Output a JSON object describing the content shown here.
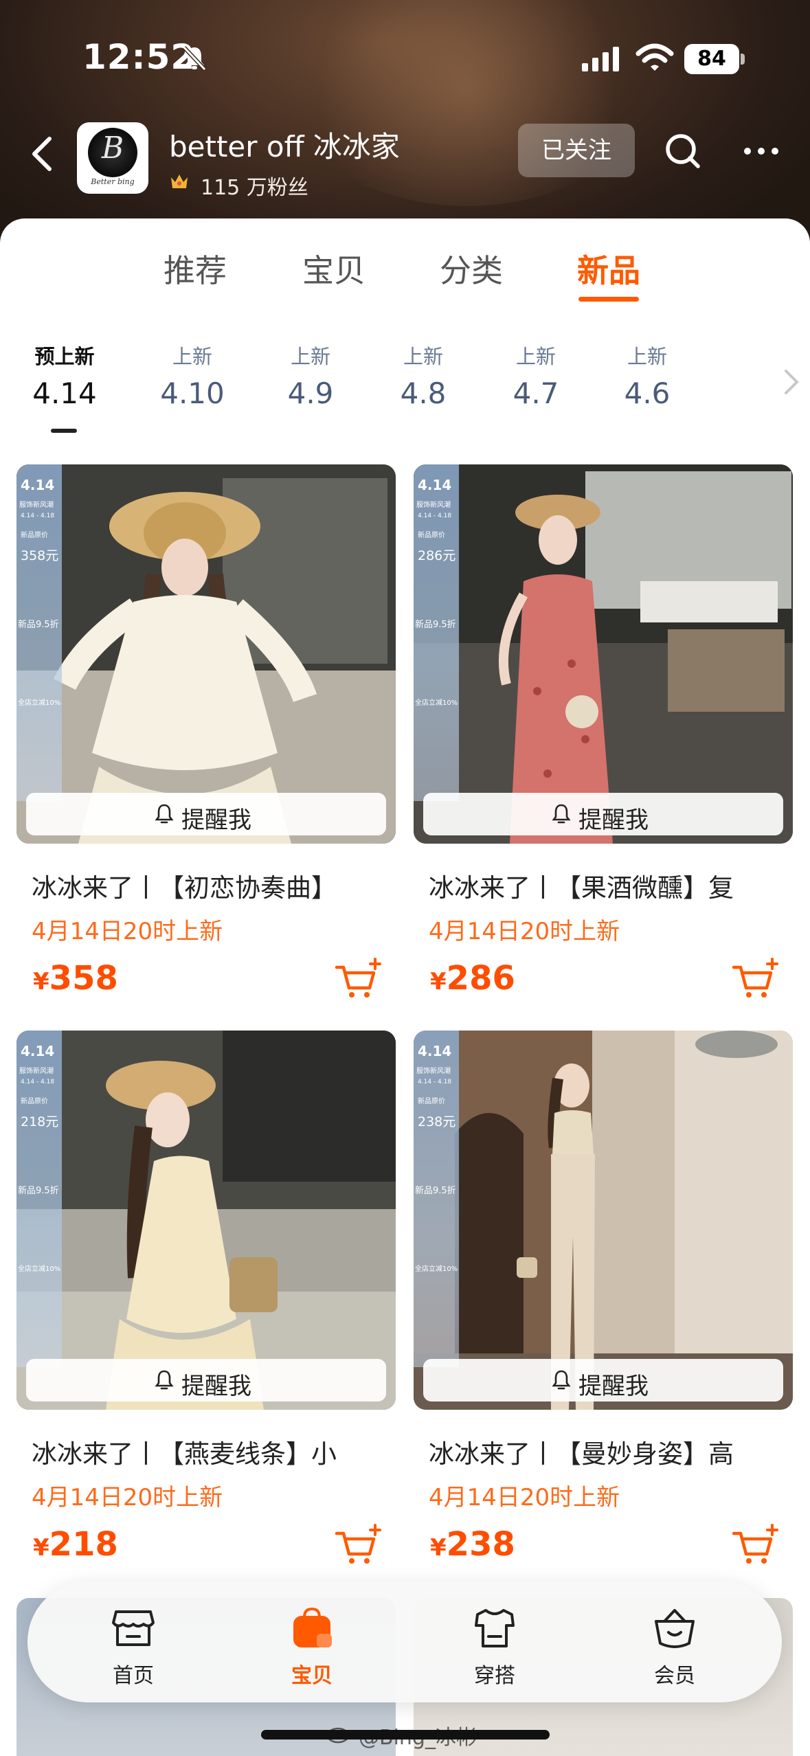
{
  "status_bar": {
    "time": "12:52",
    "battery": "84"
  },
  "store": {
    "name": "better off 冰冰家",
    "fans": "115 万粉丝",
    "follow_label": "已关注",
    "logo_letter": "B",
    "logo_script": "Better bing"
  },
  "main_tabs": [
    {
      "label": "推荐",
      "active": false
    },
    {
      "label": "宝贝",
      "active": false
    },
    {
      "label": "分类",
      "active": false
    },
    {
      "label": "新品",
      "active": true
    }
  ],
  "date_tabs": [
    {
      "label": "预上新",
      "date": "4.14",
      "active": true
    },
    {
      "label": "上新",
      "date": "4.10",
      "active": false
    },
    {
      "label": "上新",
      "date": "4.9",
      "active": false
    },
    {
      "label": "上新",
      "date": "4.8",
      "active": false
    },
    {
      "label": "上新",
      "date": "4.7",
      "active": false
    },
    {
      "label": "上新",
      "date": "4.6",
      "active": false
    }
  ],
  "promo": {
    "date": "4.14",
    "line1": "服饰新风潮",
    "line2": "4.14 - 4.18",
    "line3": "新品原价",
    "discount": "新品9.5折",
    "store_off": "全店立减10%"
  },
  "remind_label": "提醒我",
  "products": [
    {
      "title": "冰冰来了丨【初恋协奏曲】",
      "launch": "4月14日20时上新",
      "currency": "¥",
      "price": "358",
      "promo_price": "358元"
    },
    {
      "title": "冰冰来了丨【果酒微醺】复",
      "launch": "4月14日20时上新",
      "currency": "¥",
      "price": "286",
      "promo_price": "286元"
    },
    {
      "title": "冰冰来了丨【燕麦线条】小",
      "launch": "4月14日20时上新",
      "currency": "¥",
      "price": "218",
      "promo_price": "218元"
    },
    {
      "title": "冰冰来了丨【曼妙身姿】高",
      "launch": "4月14日20时上新",
      "currency": "¥",
      "price": "238",
      "promo_price": "238元"
    }
  ],
  "bottom_nav": [
    {
      "label": "首页",
      "icon": "storefront-icon",
      "active": false
    },
    {
      "label": "宝贝",
      "icon": "shopping-bag-icon",
      "active": true
    },
    {
      "label": "穿搭",
      "icon": "tshirt-icon",
      "active": false
    },
    {
      "label": "会员",
      "icon": "member-basket-icon",
      "active": false
    }
  ],
  "watermark": "@Bing_冰彬",
  "colors": {
    "accent": "#ff5a00",
    "price": "#ff4d00",
    "header_dark": "#2a1d17"
  }
}
